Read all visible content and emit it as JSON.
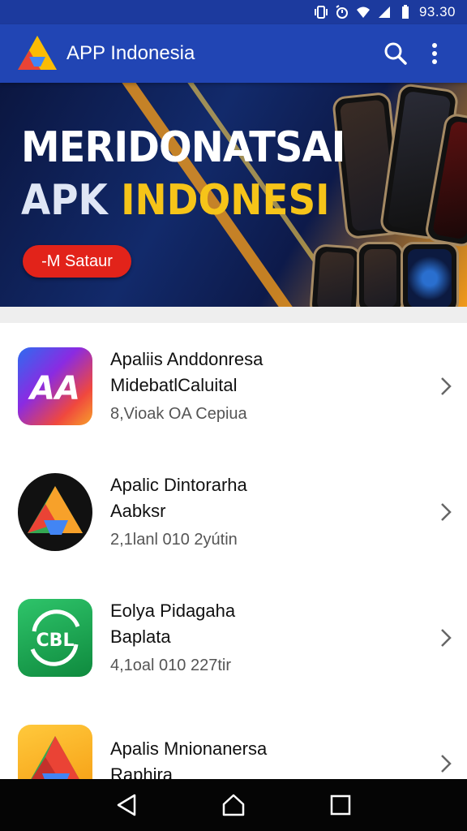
{
  "status_bar": {
    "time": "93.30",
    "icons": [
      "vibrate-icon",
      "alarm-icon",
      "wifi-icon",
      "signal-icon",
      "battery-icon"
    ]
  },
  "app_bar": {
    "title": "APP Indonesia",
    "icons": [
      "app-logo-icon",
      "search-icon",
      "more-vert-icon"
    ]
  },
  "banner": {
    "line1": "MERIDONATSAI",
    "line2_part1": "APK ",
    "line2_part2": "INDONESI",
    "button_label": "-M Sataur"
  },
  "apps": [
    {
      "name_line1": "Apaliis Anddonresa",
      "name_line2": "MidebatlCaluital",
      "meta": "8,Vioak OA Cepiua",
      "icon": "aa-logo-icon"
    },
    {
      "name_line1": "Apalic Dintorarha",
      "name_line2": "Aabksr",
      "meta": "2,1lanl 010 2yútin",
      "icon": "triangle-logo-icon"
    },
    {
      "name_line1": "Eolya Pidagaha",
      "name_line2": "Baplata",
      "meta": "4,1oal 010 227tir",
      "icon": "cbl-logo-icon"
    },
    {
      "name_line1": "Apalis Mnionanersa",
      "name_line2": "Raphira",
      "meta": "",
      "icon": "triangle-logo-icon"
    }
  ],
  "nav_bar": {
    "icons": [
      "back-icon",
      "home-icon",
      "recents-icon"
    ]
  },
  "colors": {
    "primary": "#2145b4",
    "status_bar": "#1c3a9e",
    "accent_button": "#e2231a",
    "banner_highlight": "#f6c419"
  }
}
